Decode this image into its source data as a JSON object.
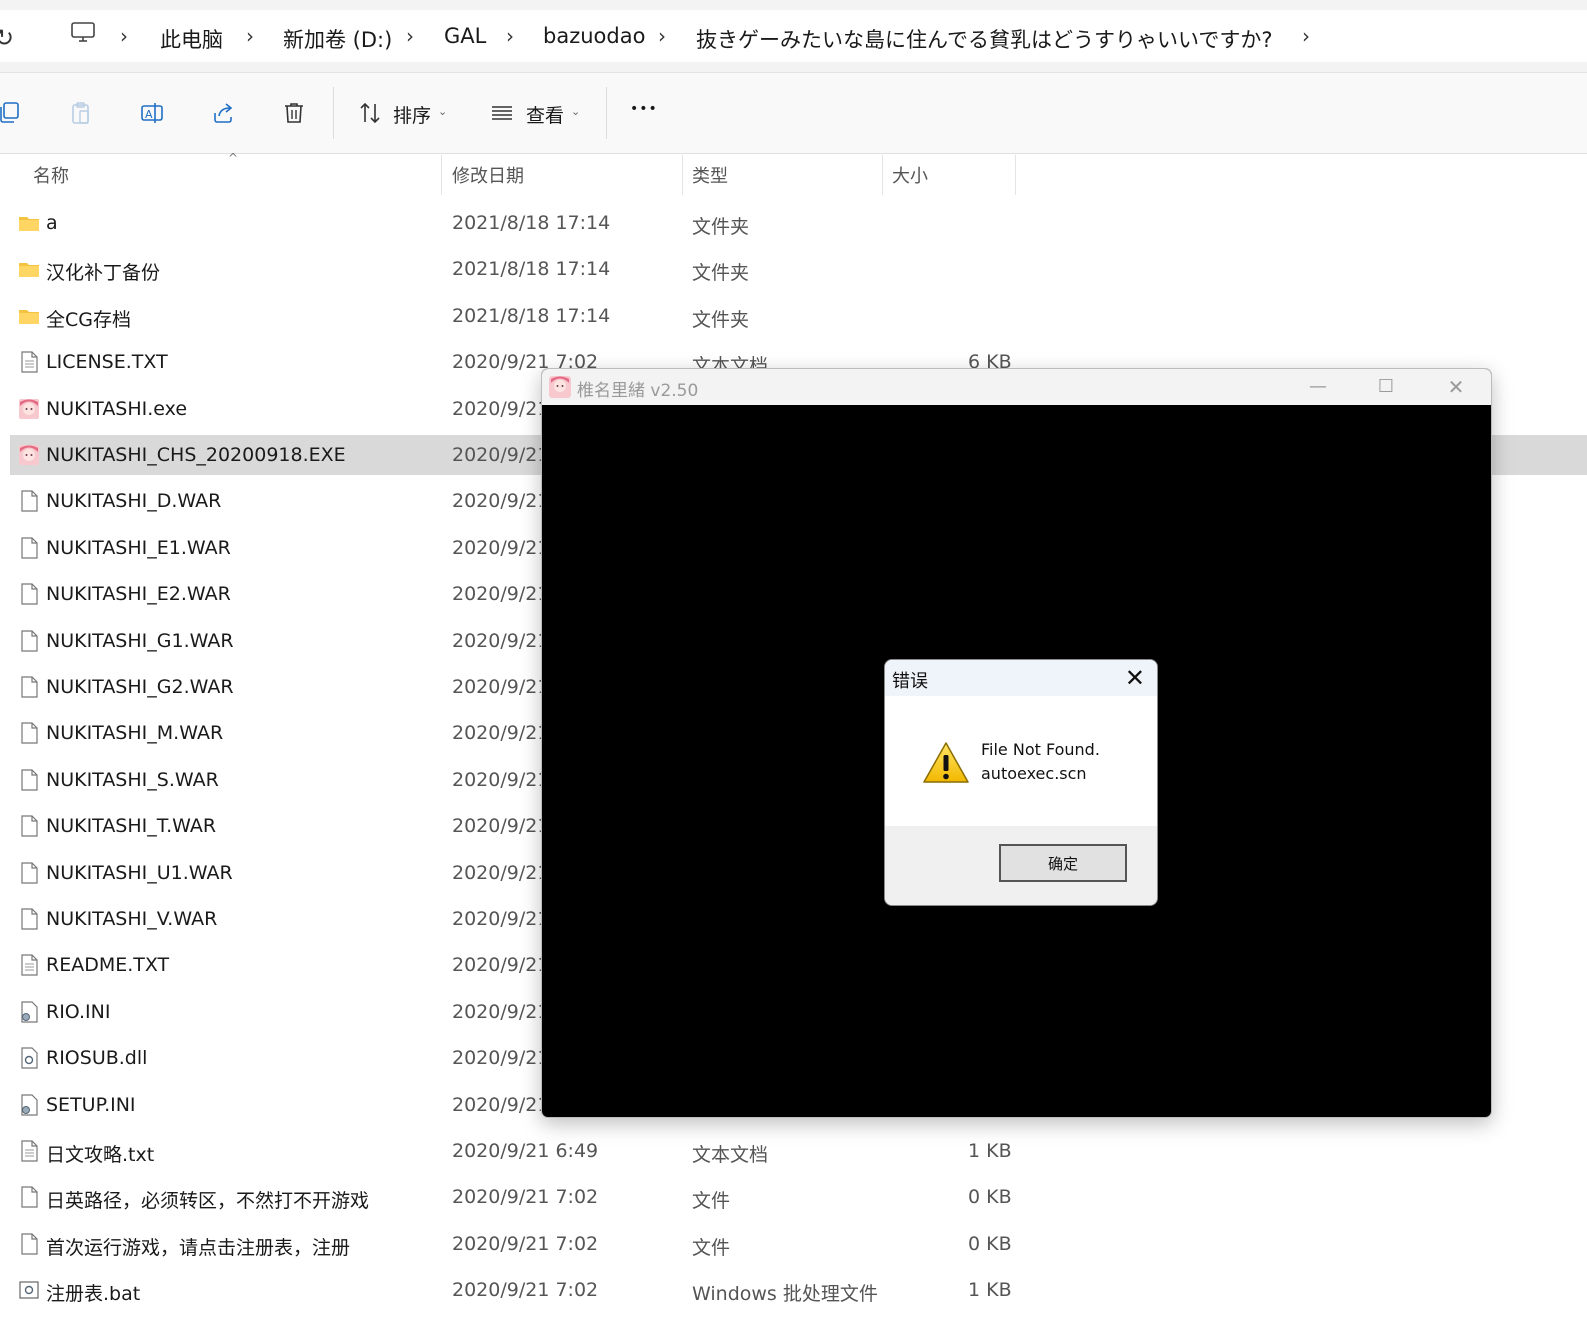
{
  "address": {
    "refresh_icon": "refresh-icon",
    "crumbs": [
      "此电脑",
      "新加卷 (D:)",
      "GAL",
      "bazuodao",
      "抜きゲーみたいな島に住んでる貧乳はどうすりゃいいですか?"
    ],
    "separator": "›"
  },
  "toolbar": {
    "sort_label": "排序",
    "view_label": "查看",
    "more_label": "•••",
    "caret": "⌄"
  },
  "columns": {
    "name": "名称",
    "date": "修改日期",
    "type": "类型",
    "size": "大小",
    "sort_indicator": "^"
  },
  "files": [
    {
      "icon": "folder-icon",
      "name": "a",
      "date": "2021/8/18 17:14",
      "type": "文件夹",
      "size": ""
    },
    {
      "icon": "folder-icon",
      "name": "汉化补丁备份",
      "date": "2021/8/18 17:14",
      "type": "文件夹",
      "size": ""
    },
    {
      "icon": "folder-icon",
      "name": "全CG存档",
      "date": "2021/8/18 17:14",
      "type": "文件夹",
      "size": ""
    },
    {
      "icon": "text-file-icon",
      "name": "LICENSE.TXT",
      "date": "2020/9/21 7:02",
      "type": "文本文档",
      "size": "6 KB"
    },
    {
      "icon": "app-icon",
      "name": "NUKITASHI.exe",
      "date": "2020/9/21",
      "type": "",
      "size": ""
    },
    {
      "icon": "app-icon",
      "name": "NUKITASHI_CHS_20200918.EXE",
      "date": "2020/9/21",
      "type": "",
      "size": "",
      "selected": true
    },
    {
      "icon": "file-icon",
      "name": "NUKITASHI_D.WAR",
      "date": "2020/9/21",
      "type": "",
      "size": ""
    },
    {
      "icon": "file-icon",
      "name": "NUKITASHI_E1.WAR",
      "date": "2020/9/21",
      "type": "",
      "size": ""
    },
    {
      "icon": "file-icon",
      "name": "NUKITASHI_E2.WAR",
      "date": "2020/9/21",
      "type": "",
      "size": ""
    },
    {
      "icon": "file-icon",
      "name": "NUKITASHI_G1.WAR",
      "date": "2020/9/21",
      "type": "",
      "size": ""
    },
    {
      "icon": "file-icon",
      "name": "NUKITASHI_G2.WAR",
      "date": "2020/9/21",
      "type": "",
      "size": ""
    },
    {
      "icon": "file-icon",
      "name": "NUKITASHI_M.WAR",
      "date": "2020/9/21",
      "type": "",
      "size": ""
    },
    {
      "icon": "file-icon",
      "name": "NUKITASHI_S.WAR",
      "date": "2020/9/21",
      "type": "",
      "size": ""
    },
    {
      "icon": "file-icon",
      "name": "NUKITASHI_T.WAR",
      "date": "2020/9/21",
      "type": "",
      "size": ""
    },
    {
      "icon": "file-icon",
      "name": "NUKITASHI_U1.WAR",
      "date": "2020/9/21",
      "type": "",
      "size": ""
    },
    {
      "icon": "file-icon",
      "name": "NUKITASHI_V.WAR",
      "date": "2020/9/21",
      "type": "",
      "size": ""
    },
    {
      "icon": "text-file-icon",
      "name": "README.TXT",
      "date": "2020/9/21",
      "type": "",
      "size": ""
    },
    {
      "icon": "settings-file-icon",
      "name": "RIO.INI",
      "date": "2020/9/21",
      "type": "",
      "size": ""
    },
    {
      "icon": "dll-file-icon",
      "name": "RIOSUB.dll",
      "date": "2020/9/21",
      "type": "",
      "size": ""
    },
    {
      "icon": "settings-file-icon",
      "name": "SETUP.INI",
      "date": "2020/9/21",
      "type": "",
      "size": ""
    },
    {
      "icon": "text-file-icon",
      "name": "日文攻略.txt",
      "date": "2020/9/21 6:49",
      "type": "文本文档",
      "size": "1 KB"
    },
    {
      "icon": "file-icon",
      "name": "日英路径，必须转区，不然打不开游戏",
      "date": "2020/9/21 7:02",
      "type": "文件",
      "size": "0 KB"
    },
    {
      "icon": "file-icon",
      "name": "首次运行游戏，请点击注册表，注册",
      "date": "2020/9/21 7:02",
      "type": "文件",
      "size": "0 KB"
    },
    {
      "icon": "batch-file-icon",
      "name": "注册表.bat",
      "date": "2020/9/21 7:02",
      "type": "Windows 批处理文件",
      "size": "1 KB"
    }
  ],
  "game_window": {
    "title": "椎名里緒 v2.50",
    "minimize": "—",
    "maximize": "☐",
    "close": "✕"
  },
  "error_dialog": {
    "title": "错误",
    "close": "✕",
    "message_line1": "File Not Found.",
    "message_line2": "autoexec.scn",
    "ok_label": "确定"
  },
  "colors": {
    "selected_row": "#d9d9d9",
    "folder": "#f5c342",
    "warning": "#f7c600"
  }
}
